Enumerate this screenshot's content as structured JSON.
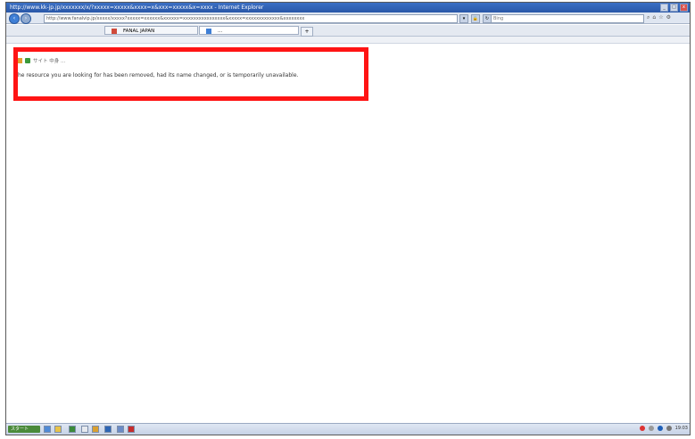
{
  "window": {
    "title": "http://www.kk-jp.jp/xxxxxxx/x/?xxxxx=xxxxx&xxxx=x&xxx=xxxxx&x=xxxx - Internet Explorer",
    "controls": {
      "minimize": "_",
      "maximize": "□",
      "close": "x"
    }
  },
  "address_bar": {
    "url": "http://www.fanalvip.jp/xxxxx/xxxxx?xxxxx=xxxxxx&xxxxxx=xxxxxxxxxxxxxxxx&xxxxx=xxxxxxxxxxxxx&xxxxxxxx",
    "search_placeholder": "Bing"
  },
  "tabs": [
    {
      "label": "FANAL JAPAN",
      "active": false
    },
    {
      "label": "...",
      "active": true
    }
  ],
  "breadcrumb": {
    "text": "サイト 中身 ..."
  },
  "page": {
    "message": "he resource you are looking for has been removed, had its name changed, or is temporarily unavailable."
  },
  "taskbar": {
    "start_label": "スタート",
    "clock": "19:03"
  },
  "colors": {
    "highlight": "#ff1414",
    "titlebar": "#2a58a8"
  }
}
